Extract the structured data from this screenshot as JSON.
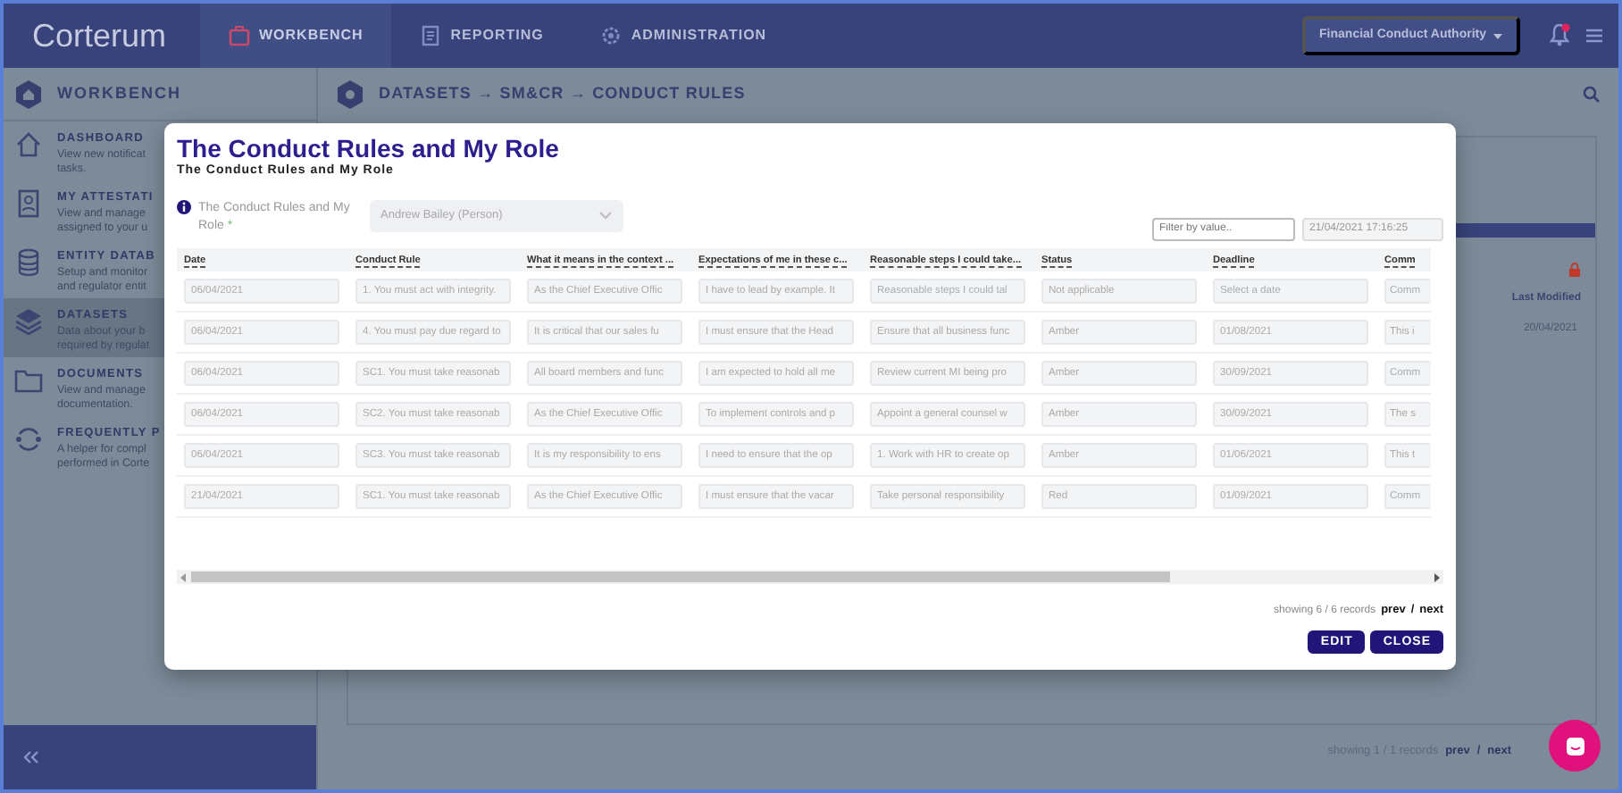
{
  "topbar": {
    "logo": "Corterum",
    "nav": [
      {
        "label": "WORKBENCH",
        "selected": true
      },
      {
        "label": "REPORTING",
        "selected": false
      },
      {
        "label": "ADMINISTRATION",
        "selected": false
      }
    ],
    "org": "Financial Conduct Authority"
  },
  "sidebar": {
    "title": "WORKBENCH",
    "items": [
      {
        "title": "DASHBOARD",
        "lines": [
          "View new notificat",
          "tasks."
        ],
        "selected": false,
        "kind": "home"
      },
      {
        "title": "MY ATTESTATI",
        "lines": [
          "View and manage",
          "assigned to your u"
        ],
        "selected": false,
        "kind": "badge"
      },
      {
        "title": "ENTITY DATAB",
        "lines": [
          "Setup and monitor",
          "and regulator entit"
        ],
        "selected": false,
        "kind": "database"
      },
      {
        "title": "DATASETS",
        "lines": [
          "Data about your b",
          "required by regulat"
        ],
        "selected": true,
        "kind": "layers"
      },
      {
        "title": "DOCUMENTS",
        "lines": [
          "View and manage",
          "documentation."
        ],
        "selected": false,
        "kind": "folder"
      },
      {
        "title": "FREQUENTLY P",
        "lines": [
          "A helper for compl",
          "performed in Corte"
        ],
        "selected": false,
        "kind": "cycle"
      }
    ]
  },
  "breadcrumb": "DATASETS → SM&CR → CONDUCT RULES",
  "background_table": {
    "columns": [
      "Last Modified"
    ],
    "rows": [
      [
        "20/04/2021"
      ]
    ],
    "footer": "showing 1 / 1 records",
    "prev": "prev",
    "separator": "/",
    "next": "next"
  },
  "modal": {
    "title": "The Conduct Rules and My Role",
    "subtitle": "The Conduct Rules and My Role",
    "field_label": "The Conduct Rules and My Role",
    "required_mark": "*",
    "select_value": "Andrew Bailey (Person)",
    "filter": {
      "placeholder": "Filter by value.."
    },
    "date": "21/04/2021 17:16:25",
    "columns": [
      "Date",
      "Conduct Rule",
      "What it means in the context ...",
      "Expectations of me in these c...",
      "Reasonable steps I could take...",
      "Status",
      "Deadline",
      "Comm"
    ],
    "rows": [
      [
        {
          "value": "06/04/2021"
        },
        {
          "value": "1. You must act with integrity."
        },
        {
          "value": "As the Chief Executive Offic"
        },
        {
          "value": "I have to lead by example.  It"
        },
        {
          "placeholder": "Reasonable steps I could tal"
        },
        {
          "value": "Not applicable"
        },
        {
          "placeholder": "Select a date"
        },
        {
          "placeholder": "Comm"
        }
      ],
      [
        {
          "value": "06/04/2021"
        },
        {
          "value": "4. You must pay due regard to"
        },
        {
          "value": "It is critical that our sales fu"
        },
        {
          "value": "I must ensure that the Head"
        },
        {
          "value": "Ensure that all business func"
        },
        {
          "value": "Amber"
        },
        {
          "value": "01/08/2021"
        },
        {
          "value": "This i"
        }
      ],
      [
        {
          "value": "06/04/2021"
        },
        {
          "value": "SC1. You must take reasonab"
        },
        {
          "value": "All board members and func"
        },
        {
          "value": "I am expected to hold all me"
        },
        {
          "value": "Review current MI being pro"
        },
        {
          "value": "Amber"
        },
        {
          "value": "30/09/2021"
        },
        {
          "placeholder": "Comm"
        }
      ],
      [
        {
          "value": "06/04/2021"
        },
        {
          "value": "SC2. You must take reasonab"
        },
        {
          "value": "As the Chief Executive Offic"
        },
        {
          "value": "To implement controls and p"
        },
        {
          "value": "Appoint a general counsel w"
        },
        {
          "value": "Amber"
        },
        {
          "value": "30/09/2021"
        },
        {
          "value": "The s"
        }
      ],
      [
        {
          "value": "06/04/2021"
        },
        {
          "value": "SC3. You must take reasonab"
        },
        {
          "value": "It is my responsibility to ens"
        },
        {
          "value": "I need to ensure that the op"
        },
        {
          "value": "1. Work with HR to create op"
        },
        {
          "value": "Amber"
        },
        {
          "value": "01/06/2021"
        },
        {
          "value": "This t"
        }
      ],
      [
        {
          "value": "21/04/2021"
        },
        {
          "value": "SC1. You must take reasonab"
        },
        {
          "value": "As the Chief Executive Offic"
        },
        {
          "value": "I must ensure that the vacar"
        },
        {
          "value": "Take personal responsibility"
        },
        {
          "value": "Red"
        },
        {
          "value": "01/09/2021"
        },
        {
          "placeholder": "Comm"
        }
      ]
    ],
    "footer": "showing 6 / 6 records",
    "prev": "prev",
    "separator": "/",
    "next": "next",
    "buttons": [
      "EDIT",
      "CLOSE"
    ]
  }
}
